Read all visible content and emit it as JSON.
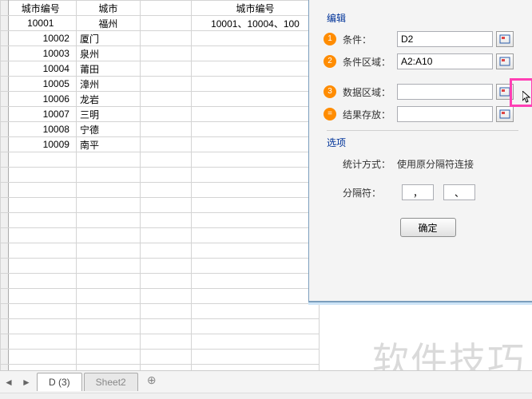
{
  "sheet": {
    "header": {
      "a": "城市编号",
      "b": "城市",
      "c": "",
      "d": "城市编号"
    },
    "row2_d": "10001、10004、100",
    "rows": [
      {
        "a": "10001",
        "b": "福州"
      },
      {
        "a": "10002",
        "b": "厦门"
      },
      {
        "a": "10003",
        "b": "泉州"
      },
      {
        "a": "10004",
        "b": "莆田"
      },
      {
        "a": "10005",
        "b": "漳州"
      },
      {
        "a": "10006",
        "b": "龙岩"
      },
      {
        "a": "10007",
        "b": "三明"
      },
      {
        "a": "10008",
        "b": "宁德"
      },
      {
        "a": "10009",
        "b": "南平"
      }
    ],
    "blank_rows": 15
  },
  "panel": {
    "section_edit": "编辑",
    "items": {
      "cond_label": "条件：",
      "cond_value": "D2",
      "cond_range_label": "条件区域：",
      "cond_range_value": "A2:A10",
      "data_range_label": "数据区域：",
      "data_range_value": "",
      "result_label": "结果存放：",
      "result_value": ""
    },
    "badges": {
      "b1": "1",
      "b2": "2",
      "b3": "3",
      "b4": "="
    },
    "section_opts": "选项",
    "stat_method_label": "统计方式：",
    "stat_method_value": "使用原分隔符连接",
    "delim_label": "分隔符：",
    "delim_a": "，",
    "delim_b": "、",
    "ok": "确定"
  },
  "tabs": {
    "prev": "◄",
    "next": "►",
    "tab1": "D (3)",
    "tab2": "Sheet2",
    "add": "⊕"
  },
  "watermark": "软件技巧"
}
